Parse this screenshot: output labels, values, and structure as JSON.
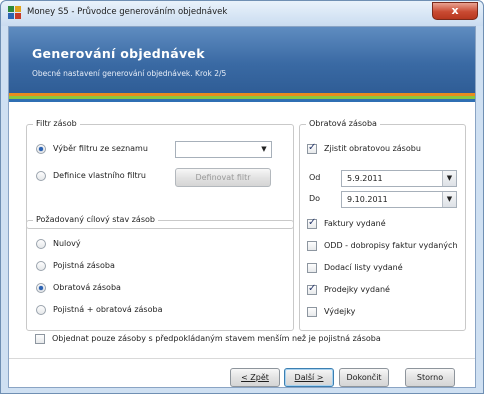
{
  "window": {
    "title": "Money S5 - Průvodce generováním objednávek",
    "close_label": "x"
  },
  "banner": {
    "title": "Generování objednávek",
    "subtitle": "Obecné nastavení generování objednávek. Krok 2/5"
  },
  "filter": {
    "legend": "Filtr zásob",
    "option_list_label": "Výběr filtru ze seznamu",
    "option_list_selected": true,
    "list_value": "",
    "option_custom_label": "Definice vlastního filtru",
    "define_button": "Definovat filtr"
  },
  "target": {
    "legend": "Požadovaný cílový stav zásob",
    "options": [
      {
        "label": "Nulový",
        "selected": false
      },
      {
        "label": "Pojistná zásoba",
        "selected": false
      },
      {
        "label": "Obratová zásoba",
        "selected": true
      },
      {
        "label": "Pojistná + obratová zásoba",
        "selected": false
      }
    ]
  },
  "turnover": {
    "legend": "Obratová zásoba",
    "detect_label": "Zjistit obratovou zásobu",
    "detect_checked": true,
    "from_label": "Od",
    "from_value": "5.9.2011",
    "to_label": "Do",
    "to_value": "9.10.2011",
    "docs": [
      {
        "label": "Faktury vydané",
        "checked": true
      },
      {
        "label": "ODD - dobropisy faktur vydaných",
        "checked": false
      },
      {
        "label": "Dodací listy vydané",
        "checked": false
      },
      {
        "label": "Prodejky vydané",
        "checked": true
      },
      {
        "label": "Výdejky",
        "checked": false
      }
    ]
  },
  "order_only": {
    "label": "Objednat pouze zásoby s předpokládaným stavem menším než je pojistná zásoba",
    "checked": false
  },
  "buttons": {
    "back": "< Zpět",
    "next": "Další >",
    "finish": "Dokončit",
    "cancel": "Storno"
  },
  "icons": {
    "app": "money-s5-app-icon",
    "dropdown": "chevron-down-icon",
    "check": "checkmark-icon"
  }
}
